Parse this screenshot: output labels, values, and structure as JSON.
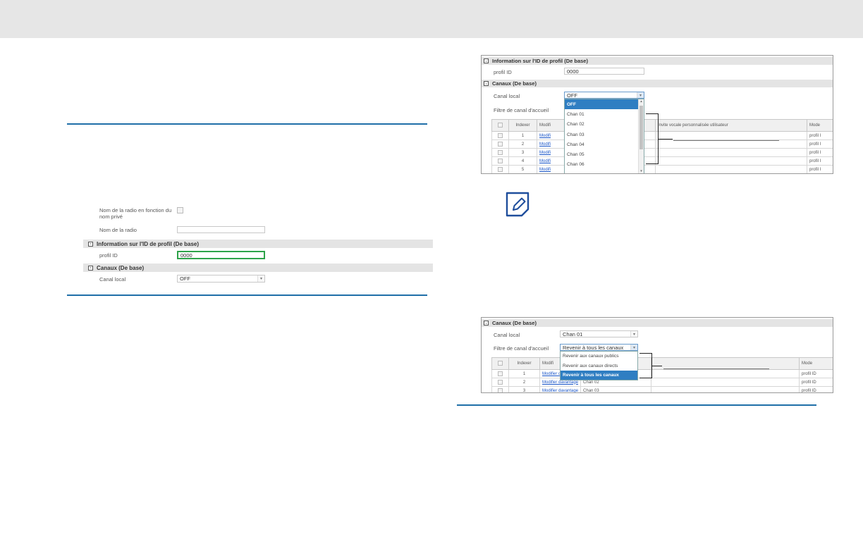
{
  "left_panel": {
    "radio_name_by_private_label": "Nom de la radio en fonction du nom privé",
    "radio_name_label": "Nom de la radio",
    "radio_name_value": "",
    "profile_section_title": "Information sur l'ID de profil (De base)",
    "profile_id_label": "profil ID",
    "profile_id_value": "0000",
    "channels_section_title": "Canaux (De base)",
    "local_channel_label": "Canal local",
    "local_channel_value": "OFF"
  },
  "right_top_panel": {
    "profile_section_title": "Information sur l'ID de profil (De base)",
    "profile_id_label": "profil ID",
    "profile_id_value": "0000",
    "channels_section_title": "Canaux (De base)",
    "local_channel_label": "Canal local",
    "local_channel_value": "OFF",
    "home_filter_label": "Filtre de canal d'accueil",
    "dropdown_options": [
      "OFF",
      "Chan 01",
      "Chan 02",
      "Chan 03",
      "Chan 04",
      "Chan 05",
      "Chan 06"
    ],
    "dropdown_selected": "OFF",
    "table": {
      "headers": {
        "index": "Indexer",
        "modify": "Modifi",
        "voice_prompt": "Invite vocale personnalisée utilisateur",
        "mode": "Mode"
      },
      "rows": [
        {
          "index": "1",
          "modify": "Modifi",
          "mode": "profil I"
        },
        {
          "index": "2",
          "modify": "Modifi",
          "mode": "profil I"
        },
        {
          "index": "3",
          "modify": "Modifi",
          "mode": "profil I"
        },
        {
          "index": "4",
          "modify": "Modifi",
          "mode": "profil I"
        },
        {
          "index": "5",
          "modify": "Modifi",
          "mode": "profil I"
        }
      ]
    }
  },
  "right_bottom_panel": {
    "channels_section_title": "Canaux (De base)",
    "local_channel_label": "Canal local",
    "local_channel_value": "Chan 01",
    "home_filter_label": "Filtre de canal d'accueil",
    "home_filter_value": "Revenir à tous les canaux",
    "dropdown_options": [
      "Revenir aux canaux publics",
      "Revenir aux canaux directs",
      "Revenir à tous les canaux"
    ],
    "dropdown_selected": "Revenir à tous les canaux",
    "table": {
      "headers": {
        "index": "Indexer",
        "modify": "Modifi",
        "mode": "Mode"
      },
      "rows": [
        {
          "index": "1",
          "modify": "Modifier davantage",
          "name": "",
          "mode": "profil ID"
        },
        {
          "index": "2",
          "modify": "Modifier davantage",
          "name": "Chan 02",
          "mode": "profil ID"
        },
        {
          "index": "3",
          "modify": "Modifier davantage",
          "name": "Chan 03",
          "mode": "profil ID"
        }
      ]
    }
  },
  "colors": {
    "accent_rule": "#1f6fa8",
    "highlight_border": "#2ea34a",
    "note_icon": "#1f4e9c",
    "selected_option": "#2f7ec2"
  },
  "icons": {
    "note": "note-pencil-icon"
  }
}
